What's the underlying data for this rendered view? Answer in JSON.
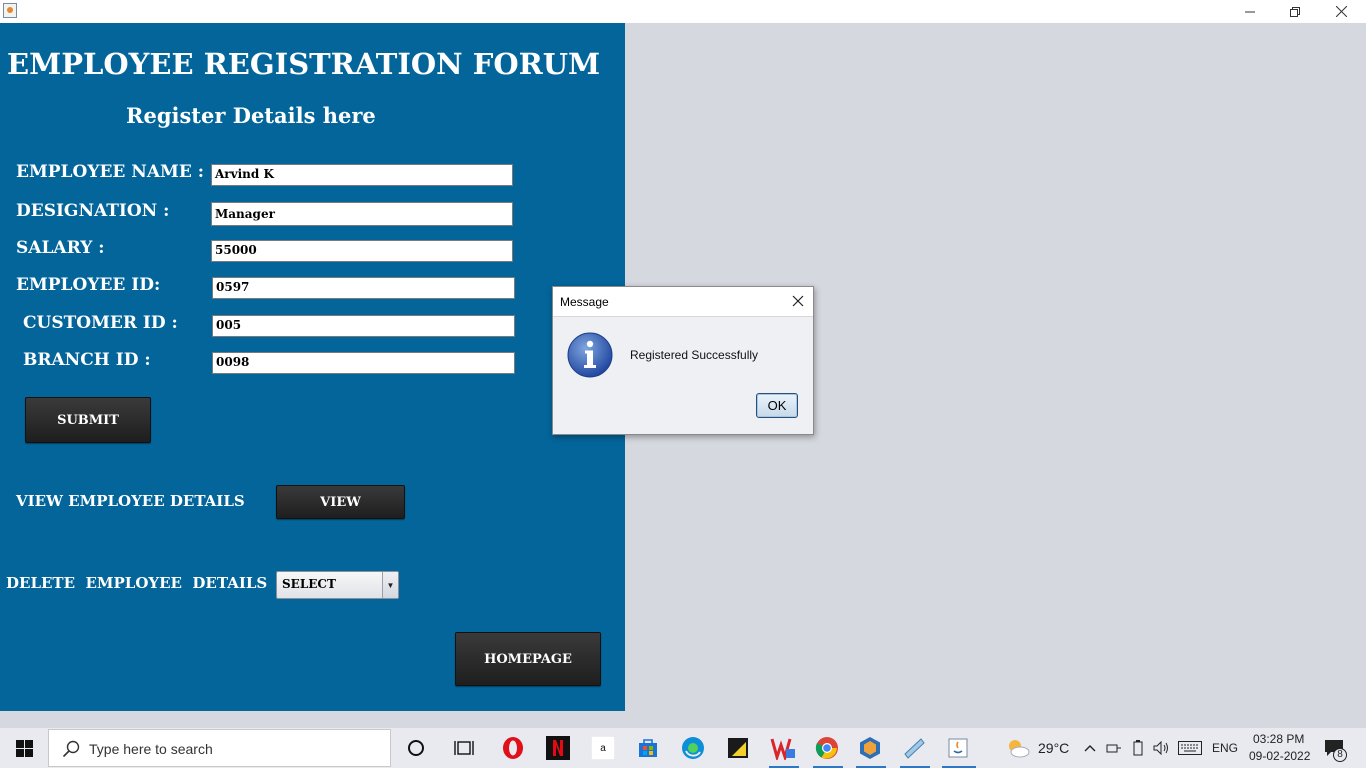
{
  "form": {
    "title": "EMPLOYEE REGISTRATION FORUM",
    "subtitle": "Register Details here",
    "fields": [
      {
        "label": "EMPLOYEE NAME :",
        "value": "Arvind K"
      },
      {
        "label": "DESIGNATION :",
        "value": "Manager"
      },
      {
        "label": "SALARY :",
        "value": "55000"
      },
      {
        "label": "EMPLOYEE ID:",
        "value": "0597"
      },
      {
        "label": "CUSTOMER ID :",
        "value": "005"
      },
      {
        "label": "BRANCH ID :",
        "value": "0098"
      }
    ],
    "submit_label": "SUBMIT",
    "view_label": "VIEW EMPLOYEE DETAILS",
    "view_button": "VIEW",
    "delete_label": "DELETE  EMPLOYEE  DETAILS",
    "delete_select": "SELECT",
    "homepage_button": "HOMEPAGE"
  },
  "dialog": {
    "title": "Message",
    "message": "Registered Successfully",
    "ok_label": "OK",
    "icon": "info-icon"
  },
  "taskbar": {
    "search_placeholder": "Type here to search",
    "weather": "29°C",
    "language": "ENG",
    "time": "03:28 PM",
    "date": "09-02-2022",
    "notifications": "8"
  },
  "colors": {
    "panel": "#03659a",
    "background": "#d6d8e0",
    "button_dark": "#2a2a2a"
  }
}
